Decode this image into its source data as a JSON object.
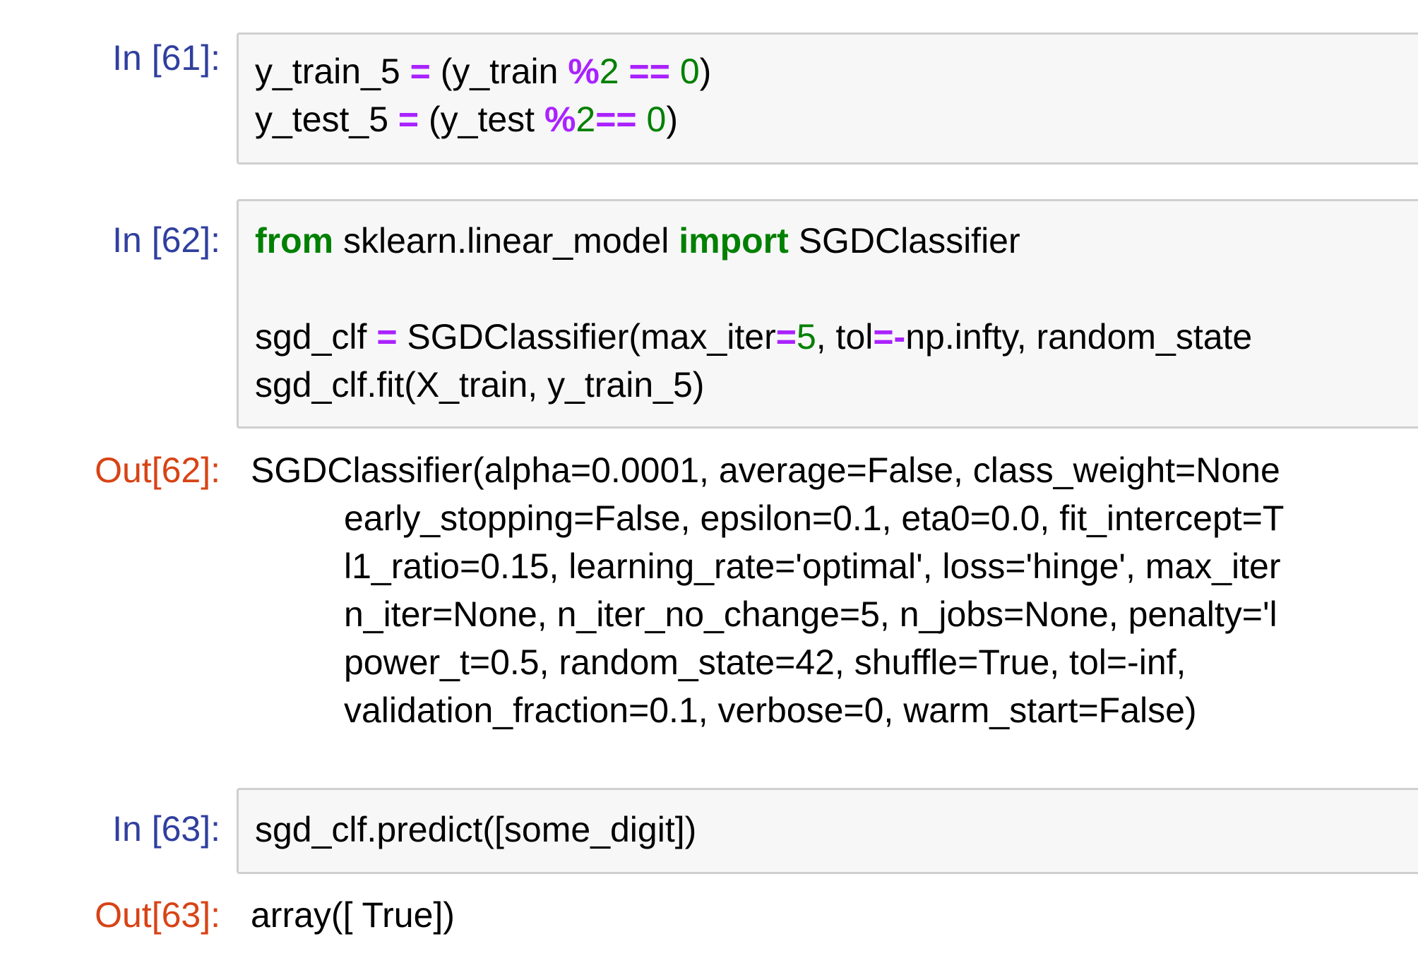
{
  "cells": {
    "c61": {
      "prompt": "In [61]:",
      "line1": {
        "a": "y_train_5 ",
        "b": "=",
        "c": " (y_train ",
        "d": "%",
        "e": "2",
        "f": " ",
        "g": "==",
        "h": " ",
        "i": "0",
        "j": ")"
      },
      "line2": {
        "a": "y_test_5 ",
        "b": "=",
        "c": " (y_test ",
        "d": "%",
        "e": "2",
        "g": "==",
        "h": " ",
        "i": "0",
        "j": ")"
      }
    },
    "c62": {
      "prompt": "In [62]:",
      "line1": {
        "kw1": "from",
        "a": " sklearn.linear_model ",
        "kw2": "import",
        "b": " SGDClassifier"
      },
      "line3": {
        "a": "sgd_clf ",
        "b": "=",
        "c": " SGDClassifier(max_iter",
        "d": "=",
        "e": "5",
        "f": ", tol",
        "g": "=-",
        "h": "np.infty, random_state"
      },
      "line4": "sgd_clf.fit(X_train, y_train_5)",
      "out_prompt": "Out[62]:",
      "out_lines": [
        "SGDClassifier(alpha=0.0001, average=False, class_weight=None",
        "early_stopping=False, epsilon=0.1, eta0=0.0, fit_intercept=T",
        "l1_ratio=0.15, learning_rate='optimal', loss='hinge', max_iter",
        "n_iter=None, n_iter_no_change=5, n_jobs=None, penalty='l",
        "power_t=0.5, random_state=42, shuffle=True, tol=-inf,",
        "validation_fraction=0.1, verbose=0, warm_start=False)"
      ]
    },
    "c63": {
      "prompt": "In [63]:",
      "line1": "sgd_clf.predict([some_digit])",
      "out_prompt": "Out[63]:",
      "out_line": "array([ True])"
    }
  },
  "colors": {
    "in_prompt": "#303f9f",
    "out_prompt": "#d84315",
    "keyword": "#008000",
    "operator": "#aa22ff",
    "number": "#008000"
  }
}
